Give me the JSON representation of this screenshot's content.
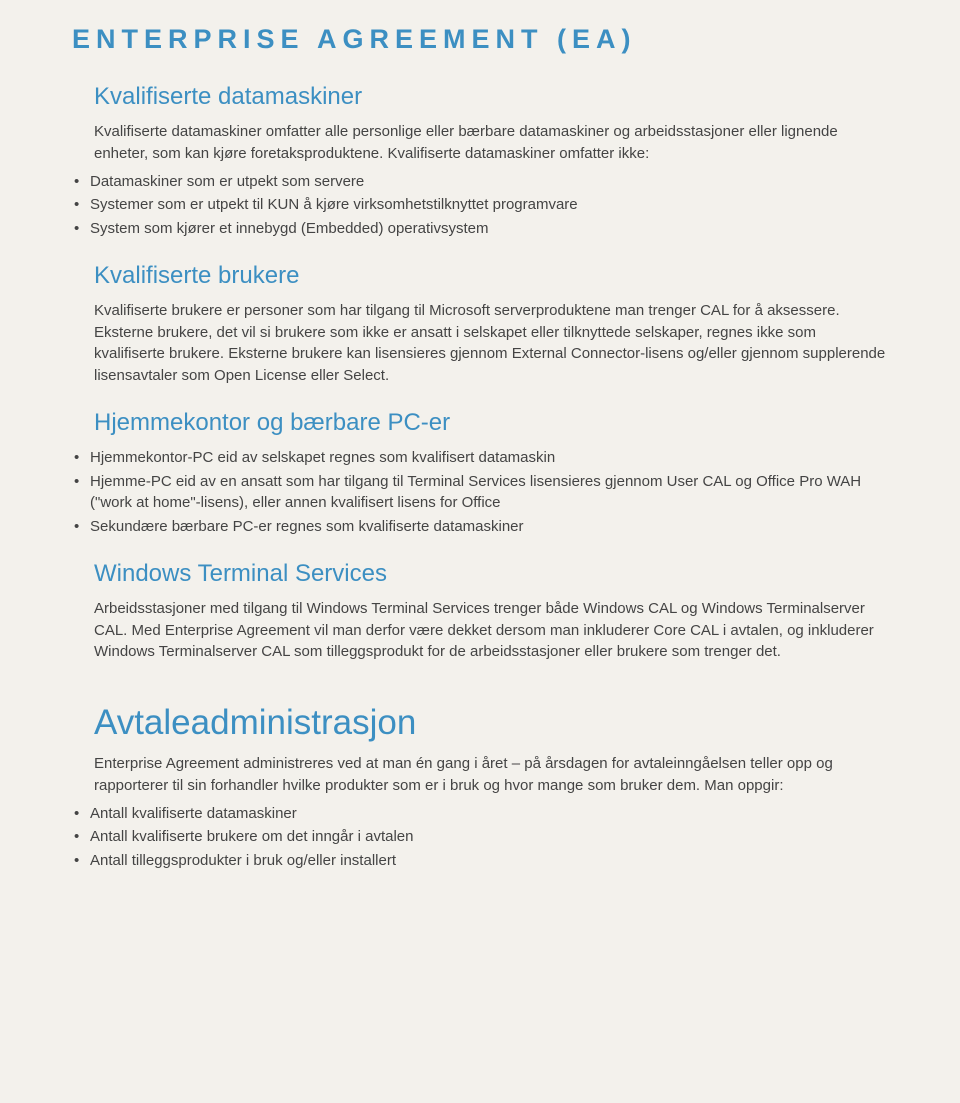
{
  "page_title": "ENTERPRISE AGREEMENT (EA)",
  "section1": {
    "heading": "Kvalifiserte datamaskiner",
    "p1": "Kvalifiserte datamaskiner omfatter alle personlige eller bærbare datamaskiner og arbeidsstasjoner eller lignende enheter, som kan kjøre foretaksproduktene. Kvalifiserte datamaskiner omfatter ikke:",
    "bullets": [
      "Datamaskiner som er utpekt som servere",
      "Systemer som er utpekt til KUN å kjøre virksomhetstilknyttet programvare",
      "System som kjører et innebygd (Embedded) operativsystem"
    ]
  },
  "section2": {
    "heading": "Kvalifiserte brukere",
    "p1": "Kvalifiserte brukere er personer som har tilgang til Microsoft serverproduktene man trenger CAL for å aksessere. Eksterne brukere, det vil si brukere som ikke er ansatt i selskapet eller tilknyttede selskaper, regnes ikke som kvalifiserte brukere. Eksterne brukere kan lisensieres gjennom External Connector-lisens og/eller gjennom supplerende lisensavtaler som Open License eller Select."
  },
  "section3": {
    "heading": "Hjemmekontor og bærbare PC-er",
    "bullets": [
      "Hjemmekontor-PC eid av selskapet regnes som kvalifisert datamaskin",
      "Hjemme-PC eid av en ansatt som har tilgang til Terminal Services lisensieres gjennom User CAL og Office Pro WAH (\"work at home\"-lisens), eller annen kvalifisert lisens for Office",
      "Sekundære bærbare PC-er regnes som kvalifiserte datamaskiner"
    ]
  },
  "section4": {
    "heading": "Windows Terminal Services",
    "p1": "Arbeidsstasjoner med tilgang til Windows Terminal Services trenger både Windows CAL og Windows Terminalserver CAL. Med Enterprise Agreement vil man derfor være dekket dersom man inkluderer Core CAL i avtalen, og inkluderer Windows Terminalserver CAL som tilleggsprodukt for de arbeidsstasjoner eller brukere som trenger det."
  },
  "section5": {
    "heading": "Avtaleadministrasjon",
    "p1": "Enterprise Agreement administreres ved at man én gang i året – på årsdagen for avtaleinngåelsen teller opp og rapporterer til sin forhandler hvilke produkter som er i bruk og hvor mange som bruker dem. Man oppgir:",
    "bullets": [
      "Antall kvalifiserte datamaskiner",
      "Antall kvalifiserte brukere om det inngår i avtalen",
      "Antall tilleggsprodukter i bruk og/eller installert"
    ]
  }
}
